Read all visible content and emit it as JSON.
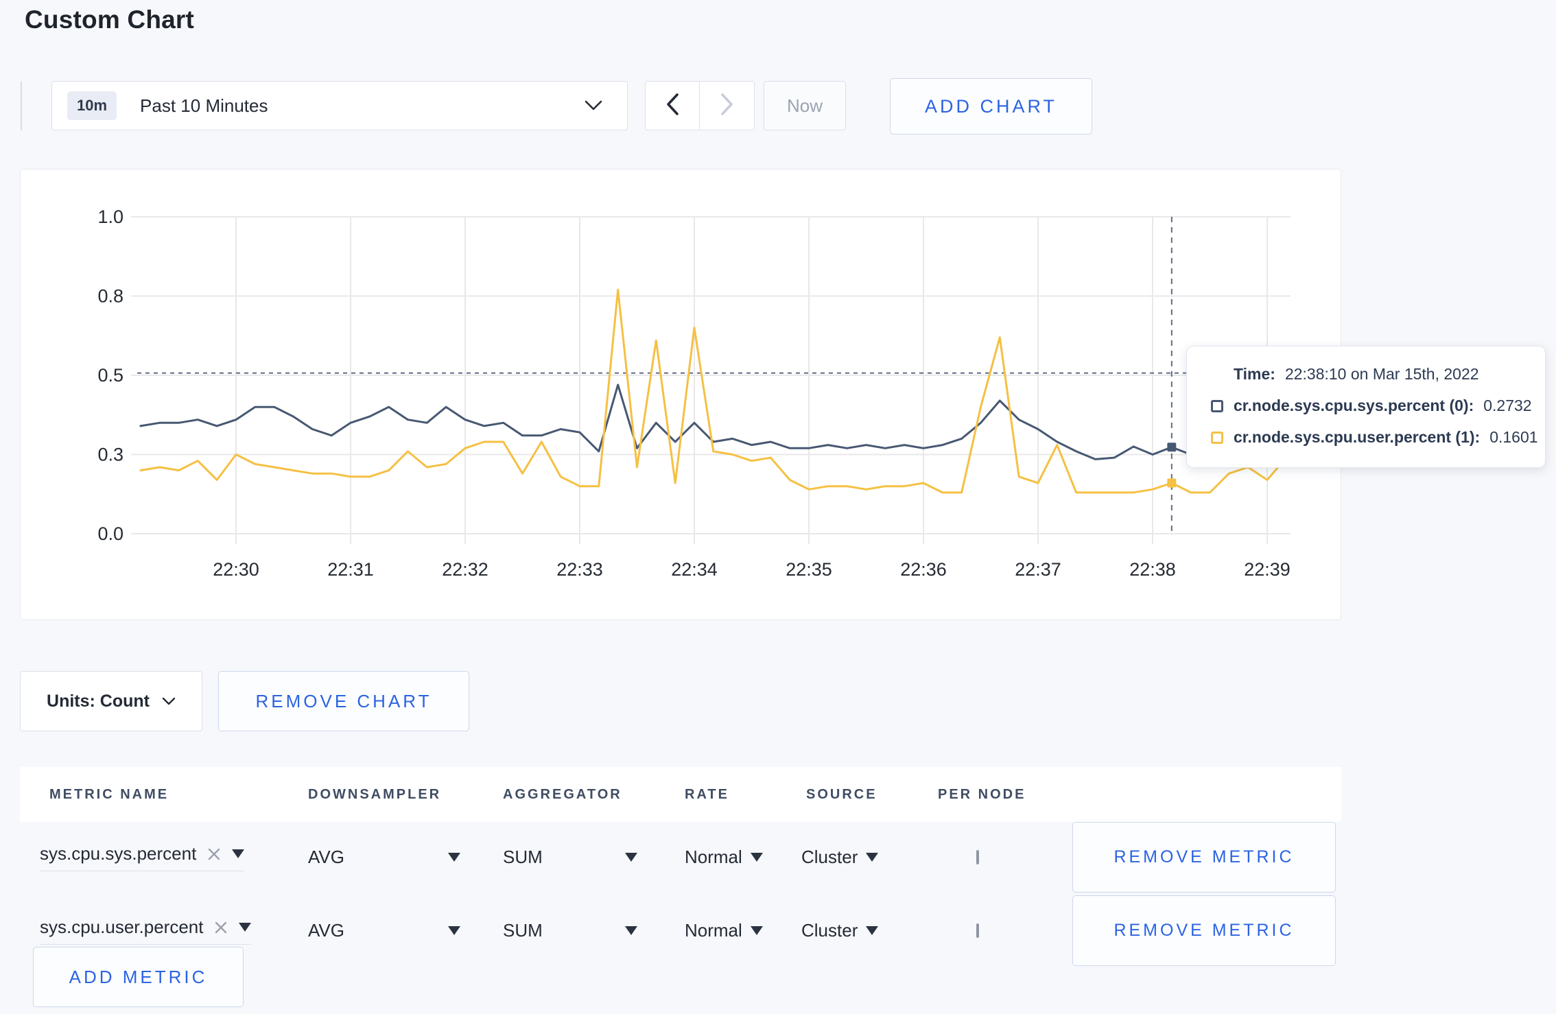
{
  "page": {
    "title": "Custom Chart",
    "background": "#f7f8fb",
    "accent_blue": "#2b63e2"
  },
  "toolbar": {
    "time_window_badge": "10m",
    "time_window_label": "Past 10 Minutes",
    "now_label": "Now",
    "add_chart_label": "ADD CHART"
  },
  "tooltip": {
    "time_label": "Time:",
    "time_value": "22:38:10 on Mar 15th, 2022",
    "series": [
      {
        "name": "cr.node.sys.cpu.sys.percent (0):",
        "value": "0.2732",
        "color": "#475872"
      },
      {
        "name": "cr.node.sys.cpu.user.percent (1):",
        "value": "0.1601",
        "color": "#f5c043"
      }
    ]
  },
  "units_row": {
    "units_label": "Units: Count",
    "remove_chart_label": "REMOVE CHART"
  },
  "metrics_table": {
    "headers": [
      "METRIC NAME",
      "DOWNSAMPLER",
      "AGGREGATOR",
      "RATE",
      "SOURCE",
      "PER NODE"
    ],
    "rows": [
      {
        "metric": "sys.cpu.sys.percent",
        "downsampler": "AVG",
        "aggregator": "SUM",
        "rate": "Normal",
        "source": "Cluster",
        "per_node_checked": false,
        "remove_label": "REMOVE METRIC"
      },
      {
        "metric": "sys.cpu.user.percent",
        "downsampler": "AVG",
        "aggregator": "SUM",
        "rate": "Normal",
        "source": "Cluster",
        "per_node_checked": false,
        "remove_label": "REMOVE METRIC"
      }
    ],
    "add_metric_label": "ADD METRIC"
  },
  "chart_data": {
    "type": "line",
    "title": "",
    "xlabel": "",
    "ylabel": "",
    "ylim": [
      0,
      1.0
    ],
    "y_tick_values": [
      0,
      0.25,
      0.5,
      0.75,
      1.0
    ],
    "y_tick_labels": [
      "0.0",
      "0.3",
      "0.5",
      "0.8",
      "1.0"
    ],
    "x_ticks": [
      "22:30",
      "22:31",
      "22:32",
      "22:33",
      "22:34",
      "22:35",
      "22:36",
      "22:37",
      "22:38",
      "22:39"
    ],
    "grid": true,
    "legend_position": "none",
    "x_start": "22:29:10",
    "x_step_seconds": 10,
    "series": [
      {
        "name": "cr.node.sys.cpu.sys.percent",
        "color": "#475872",
        "values": [
          0.34,
          0.35,
          0.35,
          0.36,
          0.34,
          0.36,
          0.4,
          0.4,
          0.37,
          0.33,
          0.31,
          0.35,
          0.37,
          0.4,
          0.36,
          0.35,
          0.4,
          0.36,
          0.34,
          0.35,
          0.31,
          0.31,
          0.33,
          0.32,
          0.26,
          0.47,
          0.27,
          0.35,
          0.29,
          0.35,
          0.29,
          0.3,
          0.28,
          0.29,
          0.27,
          0.27,
          0.28,
          0.27,
          0.28,
          0.27,
          0.28,
          0.27,
          0.28,
          0.3,
          0.35,
          0.42,
          0.36,
          0.33,
          0.29,
          0.26,
          0.235,
          0.24,
          0.275,
          0.25,
          0.2732,
          0.25,
          null,
          null,
          null,
          null,
          null
        ]
      },
      {
        "name": "cr.node.sys.cpu.user.percent",
        "color": "#f5c043",
        "values": [
          0.2,
          0.21,
          0.2,
          0.23,
          0.17,
          0.25,
          0.22,
          0.21,
          0.2,
          0.19,
          0.19,
          0.18,
          0.18,
          0.2,
          0.26,
          0.21,
          0.22,
          0.27,
          0.29,
          0.29,
          0.19,
          0.29,
          0.18,
          0.15,
          0.15,
          0.77,
          0.21,
          0.61,
          0.16,
          0.65,
          0.26,
          0.25,
          0.23,
          0.24,
          0.17,
          0.14,
          0.15,
          0.15,
          0.14,
          0.15,
          0.15,
          0.16,
          0.13,
          0.13,
          0.4,
          0.62,
          0.18,
          0.16,
          0.28,
          0.13,
          0.13,
          0.13,
          0.13,
          0.14,
          0.1601,
          0.13,
          0.13,
          0.19,
          0.21,
          0.17,
          0.24
        ]
      }
    ],
    "crosshair": {
      "time": "22:38:10",
      "minutes_after_2230": 8.1667,
      "y_value": 0.507,
      "marker_values": [
        0.2732,
        0.1601
      ]
    }
  }
}
